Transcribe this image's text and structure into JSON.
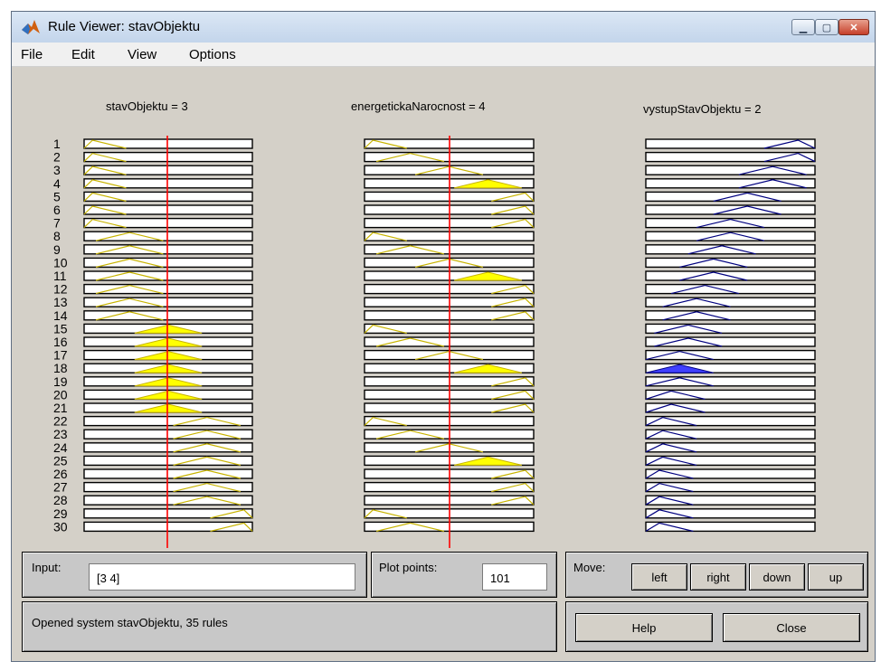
{
  "window": {
    "title": "Rule Viewer: stavObjektu",
    "controls": {
      "minimize_icon": "minimize-icon",
      "maximize_icon": "maximize-icon",
      "close_icon": "close-icon"
    }
  },
  "menu": {
    "items": [
      "File",
      "Edit",
      "View",
      "Options"
    ]
  },
  "columns": [
    {
      "title": "stavObjektu = 3",
      "input_value": 3,
      "range": [
        1,
        5
      ],
      "color": "#c8b400"
    },
    {
      "title": "energetickaNarocnost = 4",
      "input_value": 4,
      "range": [
        1,
        6
      ],
      "color": "#c8b400"
    },
    {
      "title": "vystupStavObjektu = 2",
      "range": [
        1,
        5
      ],
      "color": "#000080"
    }
  ],
  "rule_numbers": [
    "1",
    "2",
    "3",
    "4",
    "5",
    "6",
    "7",
    "8",
    "9",
    "10",
    "11",
    "12",
    "13",
    "14",
    "15",
    "16",
    "17",
    "18",
    "19",
    "20",
    "21",
    "22",
    "23",
    "24",
    "25",
    "26",
    "27",
    "28",
    "29",
    "30"
  ],
  "input_panel": {
    "label": "Input:",
    "value": "[3 4]"
  },
  "plot_points": {
    "label": "Plot points:",
    "value": "101"
  },
  "move_panel": {
    "label": "Move:",
    "buttons": [
      "left",
      "right",
      "down",
      "up"
    ]
  },
  "status": {
    "text": "Opened system stavObjektu, 35 rules"
  },
  "actions": {
    "help": "Help",
    "close": "Close"
  },
  "colors": {
    "input_mf": "#c8b400",
    "input_fill": "#ffff00",
    "output_mf": "#000080",
    "output_fill": "#4040ff",
    "indicator": "#ff0000"
  }
}
